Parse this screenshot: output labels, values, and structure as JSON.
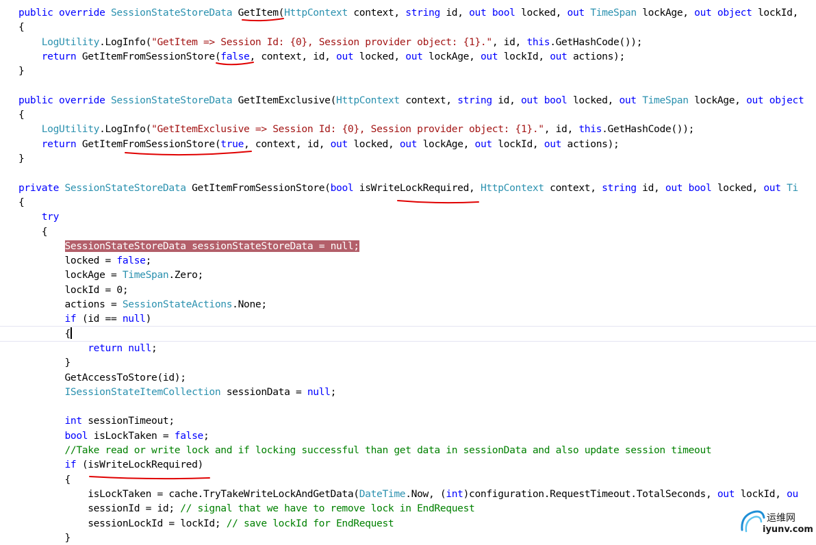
{
  "editor": {
    "colors": {
      "keyword": "#0000ff",
      "type": "#2b91af",
      "string": "#a31515",
      "comment": "#008000",
      "plain": "#000000",
      "selection": "#b35f6a",
      "annotation": "#e00000"
    },
    "lines": [
      [
        [
          "kw",
          "public override "
        ],
        [
          "ty",
          "SessionStateStoreData "
        ],
        [
          "pl",
          "GetItem("
        ],
        [
          "ty",
          "HttpContext "
        ],
        [
          "pl",
          "context, "
        ],
        [
          "kw",
          "string "
        ],
        [
          "pl",
          "id, "
        ],
        [
          "kw",
          "out bool "
        ],
        [
          "pl",
          "locked, "
        ],
        [
          "kw",
          "out "
        ],
        [
          "ty",
          "TimeSpan "
        ],
        [
          "pl",
          "lockAge, "
        ],
        [
          "kw",
          "out object "
        ],
        [
          "pl",
          "lockId, "
        ]
      ],
      [
        [
          "pl",
          "{"
        ]
      ],
      [
        [
          "pl",
          "    "
        ],
        [
          "ty",
          "LogUtility"
        ],
        [
          "pl",
          ".LogInfo("
        ],
        [
          "st",
          "\"GetItem => Session Id: {0}, Session provider object: {1}.\""
        ],
        [
          "pl",
          ", id, "
        ],
        [
          "kw",
          "this"
        ],
        [
          "pl",
          ".GetHashCode());"
        ]
      ],
      [
        [
          "pl",
          "    "
        ],
        [
          "kw",
          "return "
        ],
        [
          "pl",
          "GetItemFromSessionStore("
        ],
        [
          "kw",
          "false"
        ],
        [
          "pl",
          ", context, id, "
        ],
        [
          "kw",
          "out "
        ],
        [
          "pl",
          "locked, "
        ],
        [
          "kw",
          "out "
        ],
        [
          "pl",
          "lockAge, "
        ],
        [
          "kw",
          "out "
        ],
        [
          "pl",
          "lockId, "
        ],
        [
          "kw",
          "out "
        ],
        [
          "pl",
          "actions);"
        ]
      ],
      [
        [
          "pl",
          "}"
        ]
      ],
      [],
      [
        [
          "kw",
          "public override "
        ],
        [
          "ty",
          "SessionStateStoreData "
        ],
        [
          "pl",
          "GetItemExclusive("
        ],
        [
          "ty",
          "HttpContext "
        ],
        [
          "pl",
          "context, "
        ],
        [
          "kw",
          "string "
        ],
        [
          "pl",
          "id, "
        ],
        [
          "kw",
          "out bool "
        ],
        [
          "pl",
          "locked, "
        ],
        [
          "kw",
          "out "
        ],
        [
          "ty",
          "TimeSpan "
        ],
        [
          "pl",
          "lockAge, "
        ],
        [
          "kw",
          "out object "
        ]
      ],
      [
        [
          "pl",
          "{"
        ]
      ],
      [
        [
          "pl",
          "    "
        ],
        [
          "ty",
          "LogUtility"
        ],
        [
          "pl",
          ".LogInfo("
        ],
        [
          "st",
          "\"GetItemExclusive => Session Id: {0}, Session provider object: {1}.\""
        ],
        [
          "pl",
          ", id, "
        ],
        [
          "kw",
          "this"
        ],
        [
          "pl",
          ".GetHashCode());"
        ]
      ],
      [
        [
          "pl",
          "    "
        ],
        [
          "kw",
          "return "
        ],
        [
          "pl",
          "GetItemFromSessionStore("
        ],
        [
          "kw",
          "true"
        ],
        [
          "pl",
          ", context, id, "
        ],
        [
          "kw",
          "out "
        ],
        [
          "pl",
          "locked, "
        ],
        [
          "kw",
          "out "
        ],
        [
          "pl",
          "lockAge, "
        ],
        [
          "kw",
          "out "
        ],
        [
          "pl",
          "lockId, "
        ],
        [
          "kw",
          "out "
        ],
        [
          "pl",
          "actions);"
        ]
      ],
      [
        [
          "pl",
          "}"
        ]
      ],
      [],
      [
        [
          "kw",
          "private "
        ],
        [
          "ty",
          "SessionStateStoreData "
        ],
        [
          "pl",
          "GetItemFromSessionStore("
        ],
        [
          "kw",
          "bool "
        ],
        [
          "pl",
          "isWriteLockRequired, "
        ],
        [
          "ty",
          "HttpContext "
        ],
        [
          "pl",
          "context, "
        ],
        [
          "kw",
          "string "
        ],
        [
          "pl",
          "id, "
        ],
        [
          "kw",
          "out bool "
        ],
        [
          "pl",
          "locked, "
        ],
        [
          "kw",
          "out "
        ],
        [
          "ty",
          "Ti"
        ]
      ],
      [
        [
          "pl",
          "{"
        ]
      ],
      [
        [
          "pl",
          "    "
        ],
        [
          "kw",
          "try"
        ]
      ],
      [
        [
          "pl",
          "    {"
        ]
      ],
      [
        [
          "pl",
          "        "
        ],
        [
          "hl",
          "SessionStateStoreData sessionStateStoreData = null;"
        ]
      ],
      [
        [
          "pl",
          "        locked = "
        ],
        [
          "kw",
          "false"
        ],
        [
          "pl",
          ";"
        ]
      ],
      [
        [
          "pl",
          "        lockAge = "
        ],
        [
          "ty",
          "TimeSpan"
        ],
        [
          "pl",
          ".Zero;"
        ]
      ],
      [
        [
          "pl",
          "        lockId = 0;"
        ]
      ],
      [
        [
          "pl",
          "        actions = "
        ],
        [
          "ty",
          "SessionStateActions"
        ],
        [
          "pl",
          ".None;"
        ]
      ],
      [
        [
          "pl",
          "        "
        ],
        [
          "kw",
          "if "
        ],
        [
          "pl",
          "(id == "
        ],
        [
          "kw",
          "null"
        ],
        [
          "pl",
          ")"
        ]
      ],
      [
        [
          "pl",
          "        {"
        ]
      ],
      [
        [
          "pl",
          "            "
        ],
        [
          "kw",
          "return null"
        ],
        [
          "pl",
          ";"
        ]
      ],
      [
        [
          "pl",
          "        }"
        ]
      ],
      [
        [
          "pl",
          "        GetAccessToStore(id);"
        ]
      ],
      [
        [
          "pl",
          "        "
        ],
        [
          "ty",
          "ISessionStateItemCollection "
        ],
        [
          "pl",
          "sessionData = "
        ],
        [
          "kw",
          "null"
        ],
        [
          "pl",
          ";"
        ]
      ],
      [],
      [
        [
          "pl",
          "        "
        ],
        [
          "kw",
          "int "
        ],
        [
          "pl",
          "sessionTimeout;"
        ]
      ],
      [
        [
          "pl",
          "        "
        ],
        [
          "kw",
          "bool "
        ],
        [
          "pl",
          "isLockTaken = "
        ],
        [
          "kw",
          "false"
        ],
        [
          "pl",
          ";"
        ]
      ],
      [
        [
          "pl",
          "        "
        ],
        [
          "cm",
          "//Take read or write lock and if locking successful than get data in sessionData and also update session timeout"
        ]
      ],
      [
        [
          "pl",
          "        "
        ],
        [
          "kw",
          "if "
        ],
        [
          "pl",
          "(isWriteLockRequired)"
        ]
      ],
      [
        [
          "pl",
          "        {"
        ]
      ],
      [
        [
          "pl",
          "            isLockTaken = cache.TryTakeWriteLockAndGetData("
        ],
        [
          "ty",
          "DateTime"
        ],
        [
          "pl",
          ".Now, ("
        ],
        [
          "kw",
          "int"
        ],
        [
          "pl",
          ")configuration.RequestTimeout.TotalSeconds, "
        ],
        [
          "kw",
          "out "
        ],
        [
          "pl",
          "lockId, "
        ],
        [
          "kw",
          "ou"
        ]
      ],
      [
        [
          "pl",
          "            sessionId = id; "
        ],
        [
          "cm",
          "// signal that we have to remove lock in EndRequest"
        ]
      ],
      [
        [
          "pl",
          "            sessionLockId = lockId; "
        ],
        [
          "cm",
          "// save lockId for EndRequest"
        ]
      ],
      [
        [
          "pl",
          "        }"
        ]
      ]
    ]
  },
  "watermark": {
    "brand": "运维网",
    "domain": "iyunv.com"
  }
}
